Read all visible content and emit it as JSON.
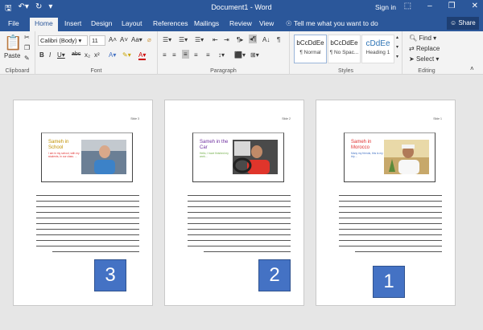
{
  "window": {
    "title": "Document1 - Word",
    "sign_in": "Sign in"
  },
  "tabs": [
    "File",
    "Home",
    "Insert",
    "Design",
    "Layout",
    "References",
    "Mailings",
    "Review",
    "View"
  ],
  "active_tab": "Home",
  "tell_me": "Tell me what you want to do",
  "share": "Share",
  "ribbon": {
    "clipboard": {
      "paste": "Paste",
      "label": "Clipboard"
    },
    "font": {
      "name": "Calibri (Body)",
      "size": "11",
      "label": "Font"
    },
    "paragraph": {
      "label": "Paragraph"
    },
    "styles": {
      "label": "Styles",
      "items": [
        {
          "sample": "bCcDdEe",
          "name": "¶ Normal"
        },
        {
          "sample": "bCcDdEe",
          "name": "¶ No Spac..."
        },
        {
          "sample": "cDdEe",
          "name": "Heading 1"
        }
      ]
    },
    "editing": {
      "find": "Find",
      "replace": "Replace",
      "select": "Select",
      "label": "Editing"
    }
  },
  "pages": [
    {
      "title": "Sameh in School",
      "title_color": "#c09000",
      "body": "I am in my school, with my students, in our class. ...",
      "body_color": "#e03030",
      "number": "3",
      "photo": "man in blue shirt indoors"
    },
    {
      "title": "Sameh in the Car",
      "title_color": "#7030a0",
      "body": "Hello, I have finished my work...",
      "body_color": "#70ad47",
      "number": "2",
      "photo": "man in red shirt driving car"
    },
    {
      "title": "Sameh in Morocco",
      "title_color": "#e03030",
      "body": "Many my friends, this is my trip ...",
      "body_color": "#4472c4",
      "number": "1",
      "photo": "man in white cap outdoors"
    }
  ],
  "colors": {
    "titlebar": "#2b579a",
    "numbox": "#4472c4"
  }
}
